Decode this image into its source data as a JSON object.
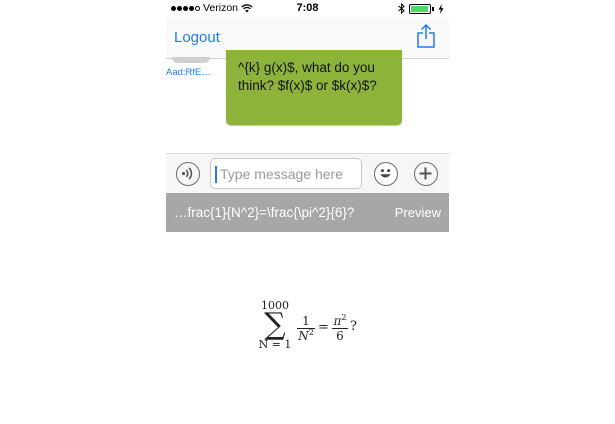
{
  "status_bar": {
    "carrier": "Verizon",
    "time": "7:08",
    "signal_dots_filled": 4,
    "signal_dots_total": 5
  },
  "nav": {
    "back_label": "Logout",
    "share_icon": "share-icon"
  },
  "chat": {
    "sender_label": "Aad:RfE…",
    "message_text": "^{k} g(x)$, what do you\nthink? $f(x)$ or $k(x)$?",
    "bubble_color": "#8eb33a"
  },
  "composer": {
    "placeholder": "Type message here",
    "audio_icon": "audio-icon",
    "emoji_icon": "emoji-icon",
    "add_icon": "plus-icon"
  },
  "preview_bar": {
    "latex_source": "…frac{1}{N^2}=\\frac{\\pi^2}{6}?",
    "preview_label": "Preview"
  },
  "rendered_math": {
    "sum_upper": "1000",
    "sum_lower": "N = 1",
    "frac1_num": "1",
    "frac1_den_base": "N",
    "frac1_den_exp": "2",
    "equals": "=",
    "frac2_num_base": "π",
    "frac2_num_exp": "2",
    "frac2_den": "6",
    "trailing": "?"
  },
  "colors": {
    "accent": "#1e7cf0",
    "preview_bar": "#a7a7a7"
  }
}
